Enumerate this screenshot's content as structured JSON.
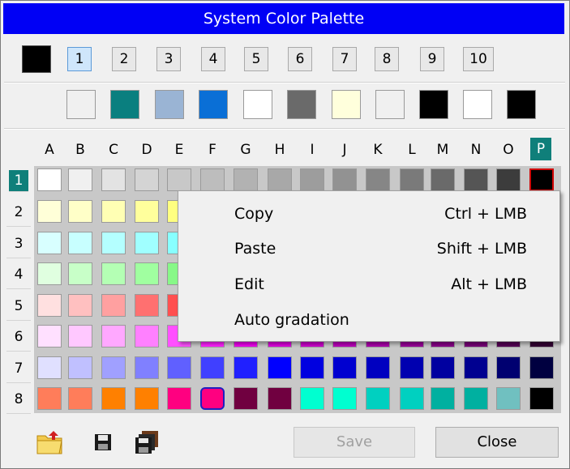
{
  "title": "System Color Palette",
  "tabs": [
    "1",
    "2",
    "3",
    "4",
    "5",
    "6",
    "7",
    "8",
    "9",
    "10"
  ],
  "selected_tab": "1",
  "current_color": "#000000",
  "quick_swatches": [
    "#f0f0f0",
    "#0a7f7f",
    "#9ab4d4",
    "#0a6fd6",
    "#ffffff",
    "#6a6a6a",
    "#ffffdc",
    "#f0f0f0",
    "#000000",
    "#ffffff",
    "#000000"
  ],
  "columns": [
    "A",
    "B",
    "C",
    "D",
    "E",
    "F",
    "G",
    "H",
    "I",
    "J",
    "K",
    "L",
    "M",
    "N",
    "O",
    "P"
  ],
  "selected_column": "P",
  "rows": [
    "1",
    "2",
    "3",
    "4",
    "5",
    "6",
    "7",
    "8"
  ],
  "selected_row": "1",
  "palette": [
    [
      "#ffffff",
      "#f0f0f0",
      "#e3e3e3",
      "#d4d4d4",
      "#c8c8c8",
      "#bdbdbd",
      "#b2b2b2",
      "#a8a8a8",
      "#9d9d9d",
      "#929292",
      "#868686",
      "#7a7a7a",
      "#6a6a6a",
      "#555555",
      "#3c3c3c",
      "#000000"
    ],
    [
      "#ffffd8",
      "#ffffc8",
      "#ffffb4",
      "#ffff9c",
      "#ffff80",
      "#ffff66",
      "#ffff4c",
      "#ffff33",
      "#ffee1a",
      "#ffdd00",
      "#eecc00",
      "#ddbb00",
      "#ccaa00",
      "#b39500",
      "#998000",
      "#7f6a00"
    ],
    [
      "#d8ffff",
      "#c8ffff",
      "#b4ffff",
      "#a0ffff",
      "#88ffff",
      "#70f0f0",
      "#58e0e0",
      "#40d0d0",
      "#30c0c0",
      "#20b0b0",
      "#10a0a0",
      "#009090",
      "#008080",
      "#007070",
      "#006060",
      "#005050"
    ],
    [
      "#e0ffe0",
      "#c8ffc8",
      "#b4ffb4",
      "#a0ffa0",
      "#88f888",
      "#70f070",
      "#58e858",
      "#40e040",
      "#30d030",
      "#20c020",
      "#10b010",
      "#00a000",
      "#009000",
      "#008000",
      "#007000",
      "#006000"
    ],
    [
      "#ffe0e0",
      "#ffc0c0",
      "#ffa0a0",
      "#ff7070",
      "#ff5050",
      "#ff3030",
      "#ff1010",
      "#ee0000",
      "#dd0000",
      "#cc0000",
      "#bb0000",
      "#aa0000",
      "#990000",
      "#880000",
      "#770000",
      "#660000"
    ],
    [
      "#ffe0ff",
      "#ffc8ff",
      "#ffa8ff",
      "#ff80ff",
      "#ff50ff",
      "#ff20ff",
      "#ee00ee",
      "#dd00dd",
      "#cc00cc",
      "#bb00bb",
      "#aa00aa",
      "#990099",
      "#880088",
      "#770077",
      "#550055",
      "#330033"
    ],
    [
      "#e0e0ff",
      "#c0c0ff",
      "#a0a0ff",
      "#8080ff",
      "#6060ff",
      "#4040ff",
      "#2020ff",
      "#0000ff",
      "#0000e0",
      "#0000d0",
      "#0000c0",
      "#0000b0",
      "#0000a0",
      "#000090",
      "#000070",
      "#000040"
    ],
    [
      "#ff7d5a",
      "#ff7d5a",
      "#ff8000",
      "#ff8000",
      "#ff0080",
      "#ff0080",
      "#700040",
      "#700040",
      "#00ffd0",
      "#00ffd0",
      "#00d0c0",
      "#00d0c0",
      "#00b0a0",
      "#00b0a0",
      "#70c0c0",
      "#000000"
    ]
  ],
  "context_menu": [
    {
      "label": "Copy",
      "shortcut": "Ctrl  + LMB"
    },
    {
      "label": "Paste",
      "shortcut": "Shift + LMB"
    },
    {
      "label": "Edit",
      "shortcut": "Alt  + LMB"
    },
    {
      "label": "Auto gradation",
      "shortcut": ""
    }
  ],
  "icons": {
    "open": "open-folder-icon",
    "save": "floppy-disk-icon",
    "save_all": "multi-floppy-icon"
  },
  "buttons": {
    "save": "Save",
    "close": "Close"
  }
}
